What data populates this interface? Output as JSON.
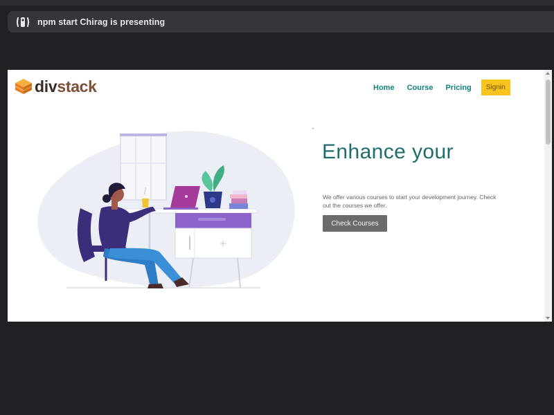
{
  "meeting": {
    "banner_text": "npm start Chirag is presenting"
  },
  "site": {
    "logo": {
      "part1": "div",
      "part2": "stack"
    },
    "nav": [
      {
        "label": "Home"
      },
      {
        "label": "Course"
      },
      {
        "label": "Pricing"
      }
    ],
    "signin_label": "Signin",
    "hero": {
      "headline": "Enhance your",
      "description": "We offer various courses to start your development journey. Check out the courses we offer.",
      "cta_label": "Check Courses"
    }
  },
  "colors": {
    "accent": "#13827c",
    "headline": "#1f6c6c",
    "signin_bg": "#f7c31c",
    "cta_bg": "#6b6b6b",
    "logo_dark": "#3b2a24",
    "logo_brown": "#7c4f36",
    "logo_orange": "#f0982a",
    "meet_bg": "#202124"
  },
  "icons": {
    "presenting": "present-to-all-icon",
    "logo_mark": "stacked-boxes-logo-icon"
  }
}
